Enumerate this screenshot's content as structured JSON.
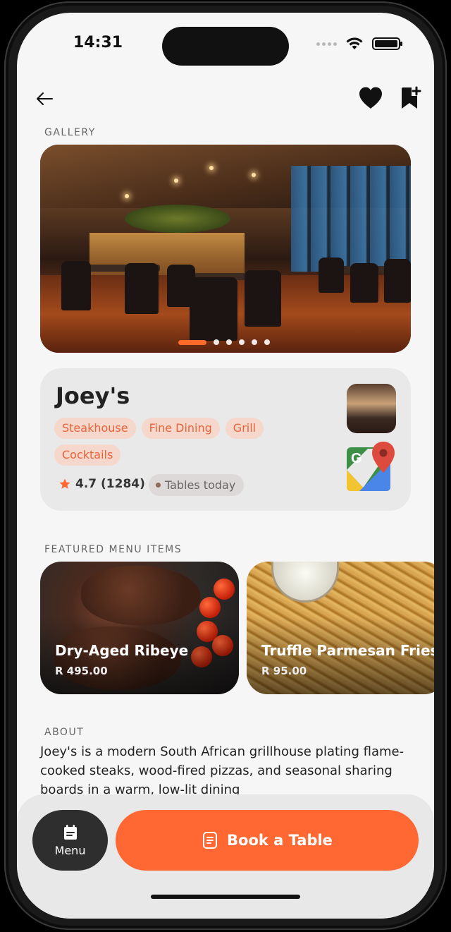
{
  "status_bar": {
    "time": "14:31"
  },
  "sections": {
    "gallery_label": "GALLERY",
    "featured_label": "FEATURED MENU ITEMS",
    "about_label": "ABOUT"
  },
  "gallery": {
    "slide_count": 6,
    "active_slide": 1
  },
  "restaurant": {
    "name": "Joey's",
    "tags": [
      "Steakhouse",
      "Fine Dining",
      "Grill",
      "Cocktails"
    ],
    "rating_text": "4.7 (1284)",
    "availability": "Tables today"
  },
  "menu_items": [
    {
      "name": "Dry-Aged Ribeye",
      "price": "R 495.00"
    },
    {
      "name": "Truffle Parmesan Fries",
      "price": "R 95.00"
    }
  ],
  "about": {
    "text": "Joey's is a modern South African grillhouse plating flame-cooked steaks, wood-fired pizzas, and seasonal sharing boards in a warm, low-lit dining"
  },
  "actions": {
    "menu_label": "Menu",
    "book_label": "Book a Table"
  },
  "colors": {
    "accent": "#ff6733",
    "tag_bg": "#f5d7cc",
    "tag_text": "#e8643a",
    "star": "#ff6733"
  },
  "icons": {
    "back": "arrow-left-icon",
    "favorite": "heart-icon",
    "save": "bookmark-plus-icon",
    "rating": "star-icon",
    "maps": "google-maps-icon",
    "menu": "calendar-menu-icon",
    "book": "document-icon"
  }
}
